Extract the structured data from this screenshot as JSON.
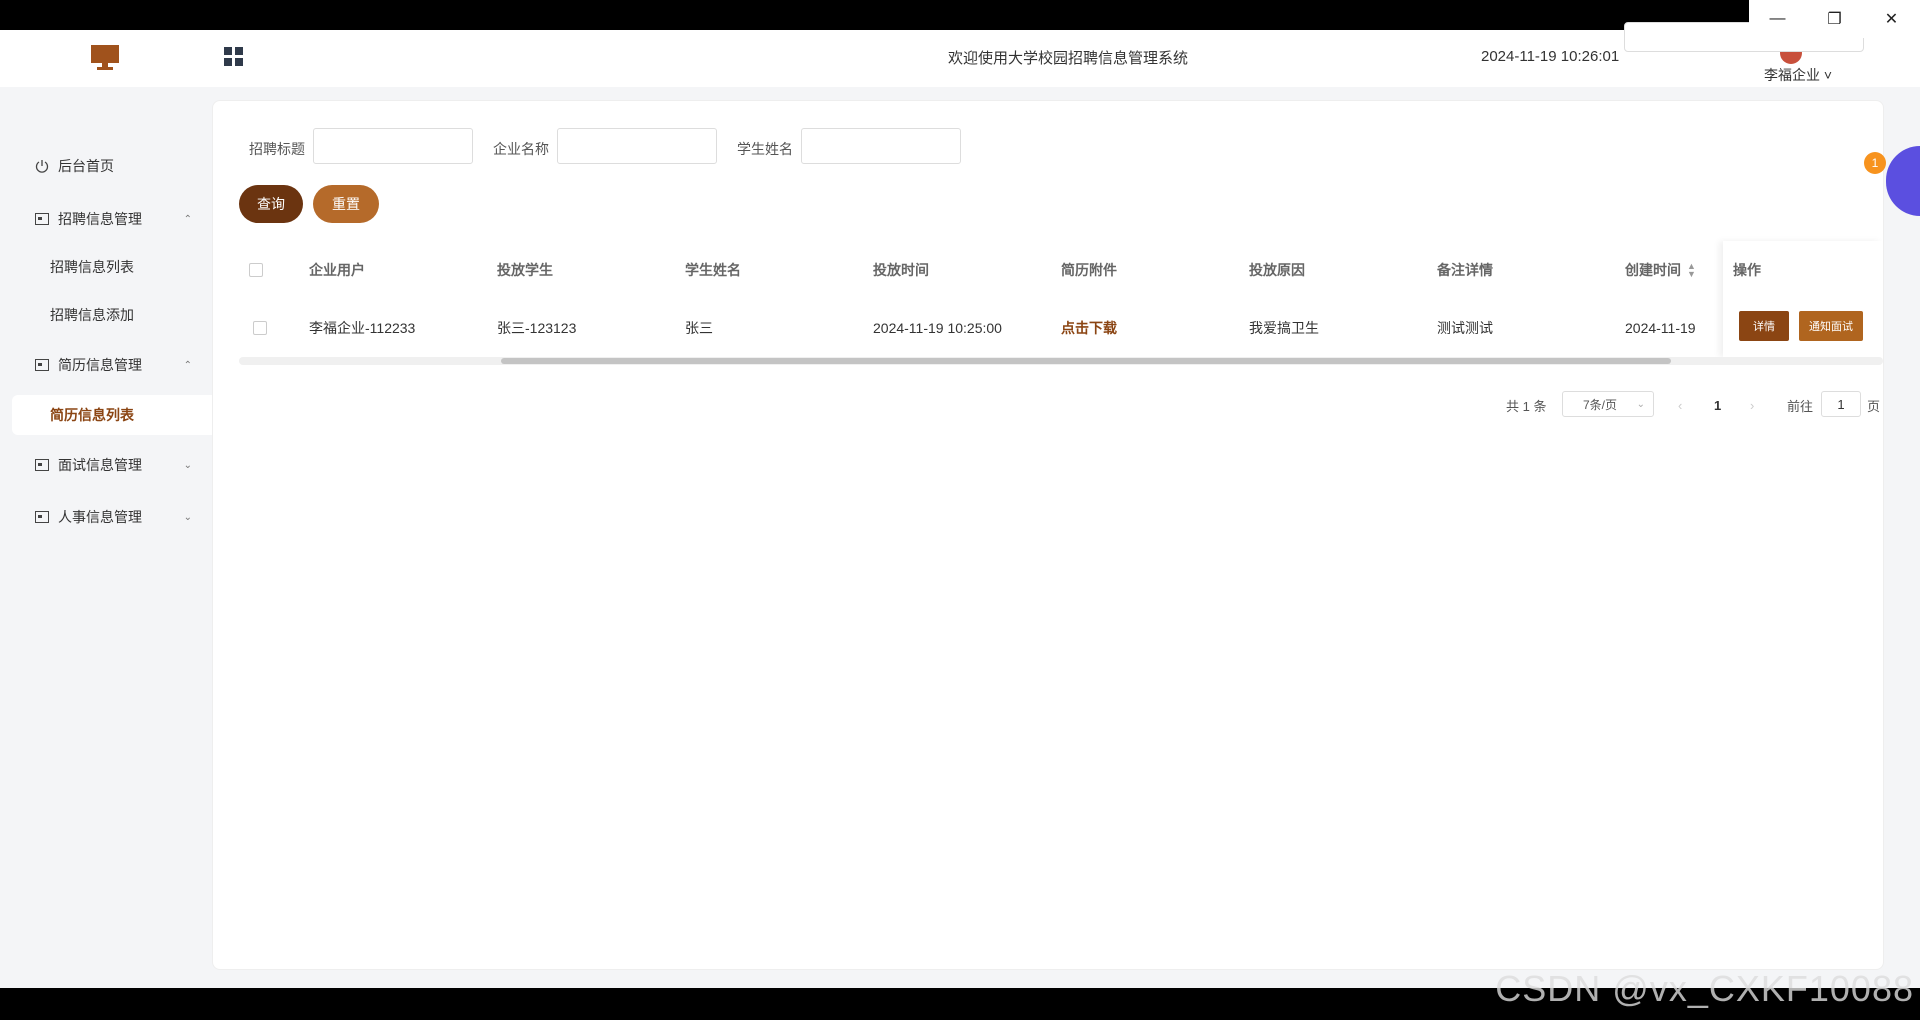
{
  "window": {
    "minimize_icon": "minimize-icon",
    "restore_icon": "restore-icon",
    "close_icon": "close-icon"
  },
  "header": {
    "title": "欢迎使用大学校园招聘信息管理系统",
    "datetime": "2024-11-19 10:26:01",
    "user": "李福企业",
    "user_caret": "˅"
  },
  "sidebar": {
    "home": "后台首页",
    "recruit_mgmt": "招聘信息管理",
    "recruit_list": "招聘信息列表",
    "recruit_add": "招聘信息添加",
    "resume_mgmt": "简历信息管理",
    "resume_list": "简历信息列表",
    "interview_mgmt": "面试信息管理",
    "hr_mgmt": "人事信息管理"
  },
  "search": {
    "title_label": "招聘标题",
    "company_label": "企业名称",
    "student_label": "学生姓名",
    "query_button": "查询",
    "reset_button": "重置"
  },
  "table": {
    "columns": [
      "企业用户",
      "投放学生",
      "学生姓名",
      "投放时间",
      "简历附件",
      "投放原因",
      "备注详情",
      "创建时间",
      "操作"
    ],
    "rows": [
      {
        "company_user": "李福企业-112233",
        "student_user": "张三-123123",
        "student_name": "张三",
        "submit_time": "2024-11-19 10:25:00",
        "attachment": "点击下载",
        "reason": "我爱搞卫生",
        "remark": "测试测试",
        "created": "2024-11-19",
        "detail_button": "详情",
        "notify_button": "通知面试"
      }
    ]
  },
  "pagination": {
    "total": "共 1 条",
    "page_size": "7条/页",
    "current": "1",
    "goto_label": "前往",
    "goto_value": "1",
    "page_unit": "页"
  },
  "badge": "1",
  "watermark": "CSDN @vx_CXKF10088",
  "colors": {
    "primary": "#6b3410",
    "accent": "#b56a2a",
    "background": "#f4f5f7"
  }
}
